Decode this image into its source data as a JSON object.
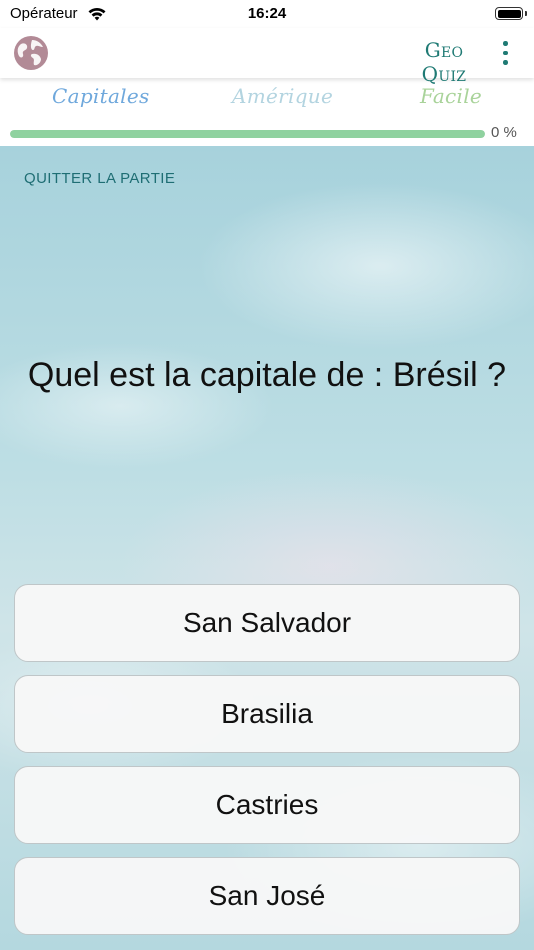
{
  "status_bar": {
    "carrier": "Opérateur",
    "time": "16:24"
  },
  "nav": {
    "title": "Geo Quiz",
    "accent_color": "#1f7a74",
    "left_icon": "globe-icon",
    "right_icon": "more-vertical-icon"
  },
  "quiz": {
    "category": "Capitales",
    "region": "Amérique",
    "difficulty": "Facile",
    "progress_percent": 0,
    "progress_label": "0 %"
  },
  "game": {
    "quit_label": "QUITTER LA PARTIE",
    "question": "Quel est la capitale de : Brésil ?",
    "answers": [
      "San Salvador",
      "Brasilia",
      "Castries",
      "San José"
    ]
  }
}
